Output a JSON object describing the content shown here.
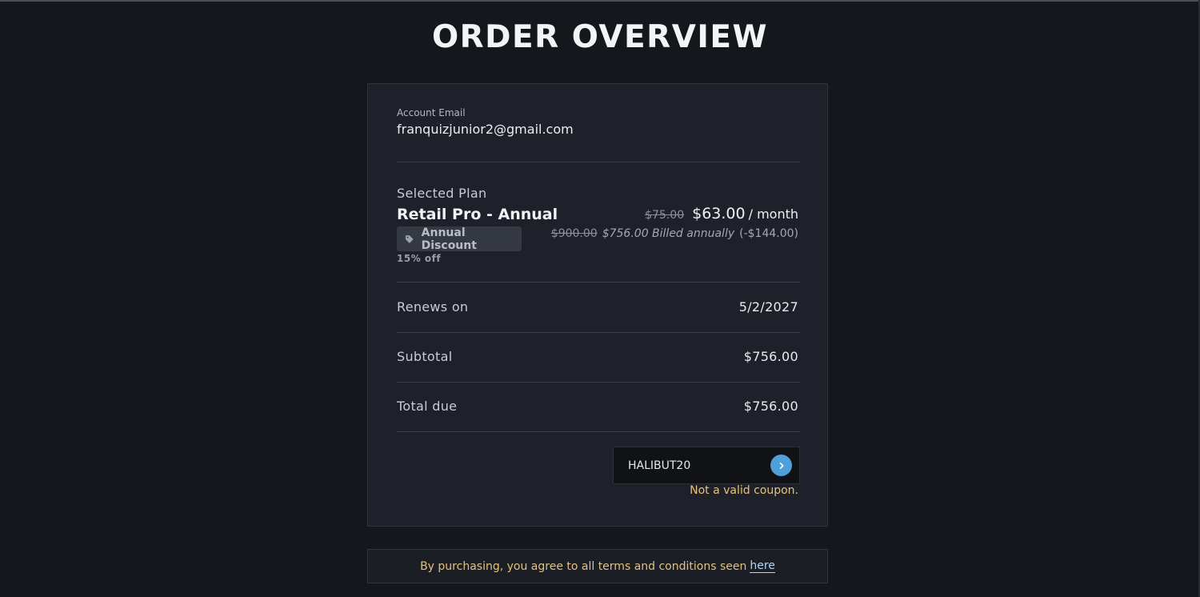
{
  "page": {
    "title": "ORDER OVERVIEW"
  },
  "account": {
    "email_label": "Account Email",
    "email_value": "franquizjunior2@gmail.com"
  },
  "plan": {
    "label": "Selected Plan",
    "name": "Retail Pro - Annual",
    "discount_badge": "Annual Discount",
    "discount_icon": "tag-icon",
    "discount_note": "15% off",
    "old_monthly_price": "$75.00",
    "new_monthly_price": "$63.00",
    "per_month": "/ month",
    "old_annual_price": "$900.00",
    "billed_annually": "$756.00 Billed annually",
    "savings": "(-$144.00)"
  },
  "summary": {
    "renews_label": "Renews on",
    "renews_value": "5/2/2027",
    "subtotal_label": "Subtotal",
    "subtotal_value": "$756.00",
    "total_label": "Total due",
    "total_value": "$756.00"
  },
  "coupon": {
    "value": "HALIBUT20",
    "submit_icon": "chevron-right-icon",
    "error": "Not a valid coupon."
  },
  "terms": {
    "text": "By purchasing, you agree to all terms and conditions seen",
    "link_label": "here"
  },
  "colors": {
    "background": "#15171c",
    "card": "#1e2129",
    "accent": "#4f9fd8",
    "warning": "#e7c27a"
  }
}
